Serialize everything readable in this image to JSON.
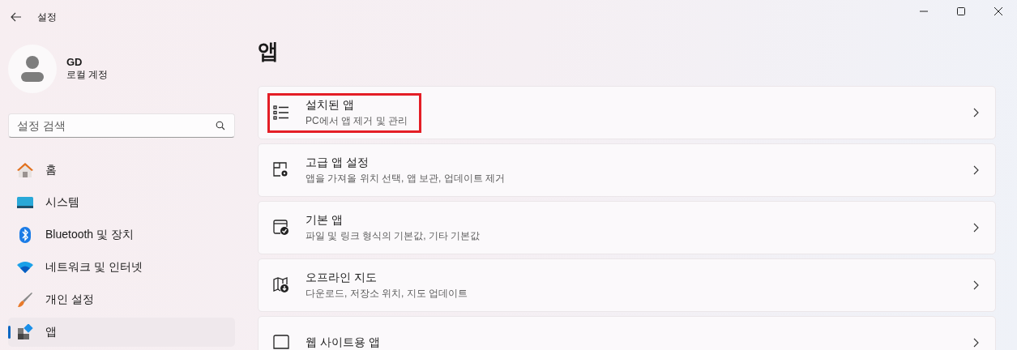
{
  "window": {
    "title": "설정"
  },
  "profile": {
    "name": "GD",
    "account": "로컬 계정"
  },
  "search": {
    "placeholder": "설정 검색"
  },
  "sidebar": {
    "items": [
      {
        "label": "홈",
        "selected": false
      },
      {
        "label": "시스템",
        "selected": false
      },
      {
        "label": "Bluetooth 및 장치",
        "selected": false
      },
      {
        "label": "네트워크 및 인터넷",
        "selected": false
      },
      {
        "label": "개인 설정",
        "selected": false
      },
      {
        "label": "앱",
        "selected": true
      }
    ]
  },
  "page": {
    "title": "앱"
  },
  "cards": [
    {
      "title": "설치된 앱",
      "subtitle": "PC에서 앱 제거 및 관리",
      "highlighted": true
    },
    {
      "title": "고급 앱 설정",
      "subtitle": "앱을 가져올 위치 선택, 앱 보관, 업데이트 제거",
      "highlighted": false
    },
    {
      "title": "기본 앱",
      "subtitle": "파일 및 링크 형식의 기본값, 기타 기본값",
      "highlighted": false
    },
    {
      "title": "오프라인 지도",
      "subtitle": "다운로드, 저장소 위치, 지도 업데이트",
      "highlighted": false
    },
    {
      "title": "웹 사이트용 앱",
      "highlighted": false
    }
  ]
}
